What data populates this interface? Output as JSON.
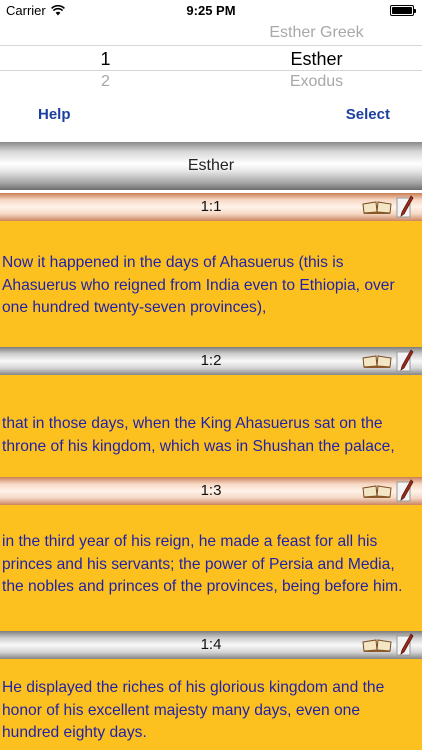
{
  "status_bar": {
    "carrier": "Carrier",
    "time": "9:25 PM"
  },
  "picker": {
    "prev": {
      "col_a": "",
      "col_b": "Esther Greek"
    },
    "selected": {
      "col_a": "1",
      "col_b": "Esther"
    },
    "next": {
      "col_a": "2",
      "col_b": "Exodus"
    }
  },
  "toolbar": {
    "help_label": "Help",
    "select_label": "Select"
  },
  "book": {
    "title": "Esther"
  },
  "verses": [
    {
      "ref": "1:1",
      "text": "Now it happened in the days of Ahasuerus (this is Ahasuerus who reigned from India even to Ethiopia, over one hundred twenty-seven provinces),"
    },
    {
      "ref": "1:2",
      "text": "that in those days, when the King Ahasuerus sat on the throne of his kingdom, which was in Shushan the palace,"
    },
    {
      "ref": "1:3",
      "text": "in the third year of his reign, he made a feast for all his princes and his servants; the power of Persia and Media, the nobles and princes of the provinces, being before him."
    },
    {
      "ref": "1:4",
      "text": "He displayed the riches of his glorious kingdom and the honor of his excellent majesty many days, even one hundred eighty days."
    }
  ],
  "colors": {
    "verse_background": "#fdc11f",
    "verse_text": "#2222a8",
    "button_text": "#1c3fa0"
  },
  "icons": {
    "verse_actions": [
      "book-icon",
      "pen-icon"
    ]
  }
}
